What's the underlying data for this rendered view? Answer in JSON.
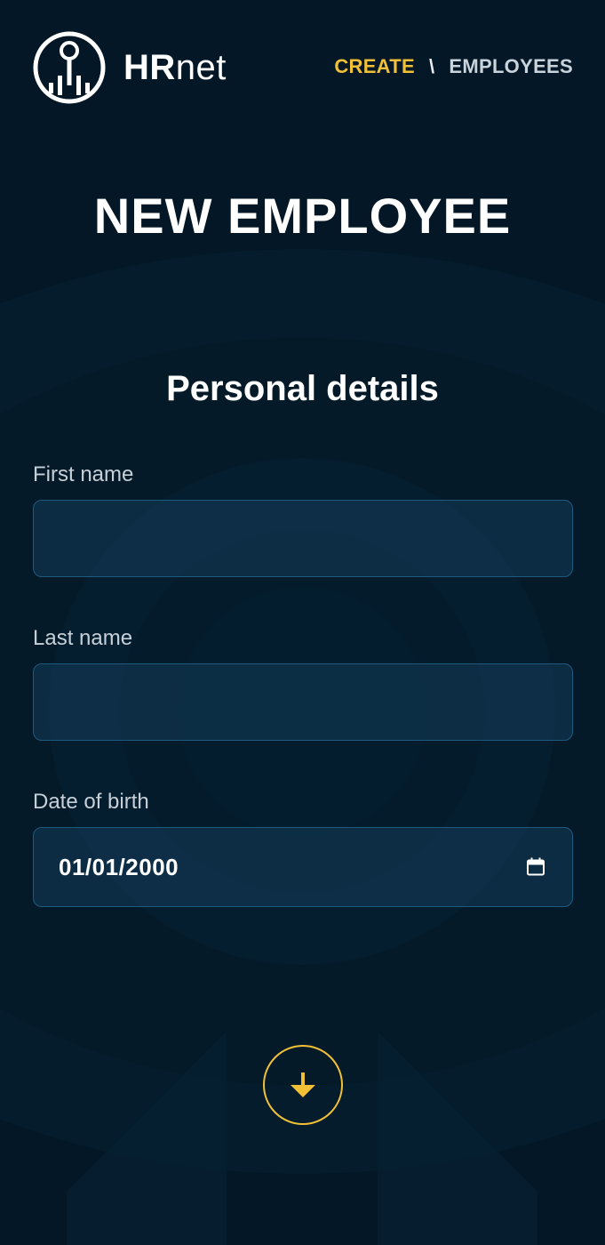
{
  "header": {
    "logo": {
      "brand_bold": "HR",
      "brand_light": "net"
    },
    "nav": {
      "active": "CREATE",
      "separator": "\\",
      "link": "EMPLOYEES"
    }
  },
  "main": {
    "title": "NEW EMPLOYEE",
    "section_title": "Personal details",
    "fields": {
      "first_name": {
        "label": "First name",
        "value": "",
        "placeholder": ""
      },
      "last_name": {
        "label": "Last name",
        "value": "",
        "placeholder": ""
      },
      "date_of_birth": {
        "label": "Date of birth",
        "value": "01/01/2000",
        "icon": "calendar-icon"
      }
    },
    "scroll_button": {
      "icon": "arrow-down-icon"
    }
  },
  "colors": {
    "background": "#041726",
    "accent": "#f2c037",
    "input_bg": "#0f2f47",
    "input_border": "#1e5a80",
    "text": "#ffffff",
    "muted_text": "#c7d0d8"
  }
}
